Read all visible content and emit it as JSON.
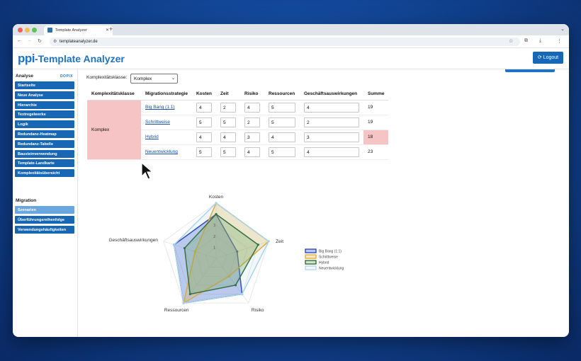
{
  "browser": {
    "tab_title": "Template Analyzer",
    "url": "templateanalyzer.de"
  },
  "header": {
    "logo_mark": "ppi",
    "title": "-Template Analyzer",
    "logout_label": "Logout"
  },
  "sidebar": {
    "analyse_title": "Analyse",
    "brand": "DOPIX",
    "analyse_items": [
      {
        "label": "Startseite"
      },
      {
        "label": "Neue Analyse"
      },
      {
        "label": "Hierarchie"
      },
      {
        "label": "Textregelwerke"
      },
      {
        "label": "Logik"
      },
      {
        "label": "Redundanz-Heatmap"
      },
      {
        "label": "Redundanz-Tabelle"
      },
      {
        "label": "Bausteinverwendung"
      },
      {
        "label": "Template-Landkarte"
      },
      {
        "label": "Komplexitätsübersicht"
      }
    ],
    "migration_title": "Migration",
    "migration_items": [
      {
        "label": "Szenarien",
        "active": true
      },
      {
        "label": "Überführungsreihenfolge"
      },
      {
        "label": "Verwendungshäufigkeiten"
      }
    ]
  },
  "filter": {
    "label": "Komplexitätsklasse:",
    "selected": "Komplex"
  },
  "table": {
    "headers": [
      "Komplexitätsklasse",
      "Migrationsstrategie",
      "Kosten",
      "Zeit",
      "Risiko",
      "Ressourcen",
      "Geschäftsauswirkungen",
      "Summe"
    ],
    "klasse": "Komplex",
    "rows": [
      {
        "strategy": "Big Bang (1:1)",
        "kosten": "4",
        "zeit": "2",
        "risiko": "4",
        "ressourcen": "5",
        "geschaeft": "4",
        "summe": "19"
      },
      {
        "strategy": "Schrittweise",
        "kosten": "5",
        "zeit": "5",
        "risiko": "2",
        "ressourcen": "5",
        "geschaeft": "2",
        "summe": "19"
      },
      {
        "strategy": "Hybrid",
        "kosten": "4",
        "zeit": "4",
        "risiko": "3",
        "ressourcen": "4",
        "geschaeft": "3",
        "summe": "18"
      },
      {
        "strategy": "Neuentwicklung",
        "kosten": "5",
        "zeit": "5",
        "risiko": "4",
        "ressourcen": "5",
        "geschaeft": "4",
        "summe": "23"
      }
    ]
  },
  "colors": {
    "accent": "#1767b5",
    "highlight": "#f6c4c4"
  },
  "chart_data": {
    "type": "radar",
    "axes": [
      "Kosten",
      "Zeit",
      "Risiko",
      "Ressourcen",
      "Geschäftsauswirkungen"
    ],
    "range": [
      0,
      5
    ],
    "ticks": [
      "1",
      "2",
      "3"
    ],
    "series": [
      {
        "name": "Big Bang (1:1)",
        "values": [
          4,
          2,
          4,
          5,
          4
        ],
        "stroke": "#1a2fb0",
        "fill": "rgba(40,70,200,0.30)"
      },
      {
        "name": "Schrittweise",
        "values": [
          5,
          5,
          2,
          5,
          2
        ],
        "stroke": "#e6a020",
        "fill": "rgba(235,175,50,0.28)"
      },
      {
        "name": "Hybrid",
        "values": [
          4,
          4,
          3,
          4,
          3
        ],
        "stroke": "#1f5a22",
        "fill": "rgba(80,150,60,0.28)"
      },
      {
        "name": "Neuentwicklung",
        "values": [
          5,
          5,
          4,
          5,
          4
        ],
        "stroke": "#a8d4ea",
        "fill": "rgba(170,215,235,0.18)"
      }
    ]
  }
}
